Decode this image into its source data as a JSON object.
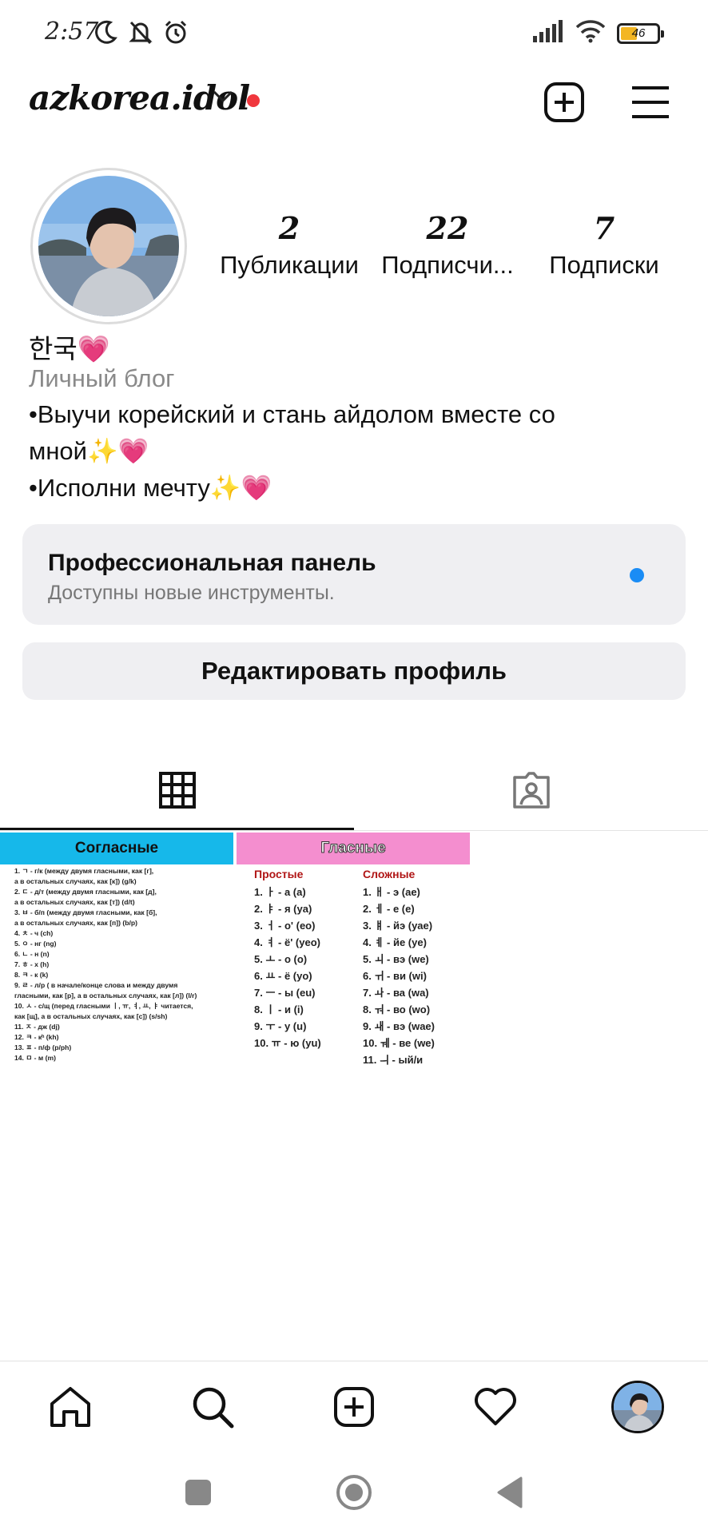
{
  "status_bar": {
    "time": "2:57",
    "battery_level": "46",
    "battery_fraction": 0.46
  },
  "header": {
    "username": "azkorea.idol"
  },
  "profile": {
    "stats": [
      {
        "value": "2",
        "label": "Публикации"
      },
      {
        "value": "22",
        "label": "Подписчи..."
      },
      {
        "value": "7",
        "label": "Подписки"
      }
    ],
    "name": "한국💗",
    "category": "Личный блог",
    "bio": "•Выучи корейский и стань айдолом вместе со\nмной✨💗\n•Исполни мечту✨💗"
  },
  "pro_panel": {
    "title": "Профессиональная панель",
    "subtitle": "Доступны новые инструменты."
  },
  "edit_button": "Редактировать профиль",
  "posts": [
    {
      "title": "Согласные",
      "lines": [
        "1. ㄱ - г/к (между двумя гласными, как [г],",
        "а в остальных случаях, как [к]) (g/k)",
        "2. ㄷ - д/т (между двумя гласными, как [д],",
        "а в остальных случаях, как [т]) (d/t)",
        "3. ㅂ - б/п (между двумя гласными, как [б],",
        "а в остальных случаях, как [п]) (b/p)",
        "4. ㅊ - ч (ch)",
        "5. ㅇ - нг (ng)",
        "6. ㄴ - н (n)",
        "7. ㅎ - х (h)",
        "8. ㅋ - к (k)",
        "9. ㄹ - л/р ( в начале/конце слова и между двумя",
        "гласными, как [р], а в остальных случаях, как [л]) (l/r)",
        "10. ㅅ - с/щ (перед гласными ㅣ, ㅠ, ㅕ, ㅛ, ㅑ читается,",
        "как [щ], а в остальных случаях, как [с]) (s/sh)",
        "11. ㅈ - дж (dj)",
        "12. ㅋ - кʰ (kh)",
        "13. ㅍ - п/ф (p/ph)",
        "14. ㅁ - м (m)"
      ]
    },
    {
      "title": "Гласные",
      "simple_title": "Простые",
      "complex_title": "Сложные",
      "simple": [
        "1. ㅏ - а (a)",
        "2. ㅑ - я (ya)",
        "3. ㅓ - о' (eo)",
        "4. ㅕ - ё' (yeo)",
        "5. ㅗ - о (o)",
        "6. ㅛ - ё (yo)",
        "7. ㅡ - ы (eu)",
        "8. ㅣ - и (i)",
        "9. ㅜ - у (u)",
        "10. ㅠ - ю (yu)"
      ],
      "complex": [
        "1. ㅐ - э (ae)",
        "2. ㅔ - е (e)",
        "3. ㅒ - йэ (yae)",
        "4. ㅖ - йе (ye)",
        "5. ㅚ - вэ (we)",
        "6. ㅟ - ви (wi)",
        "7. ㅘ - ва (wa)",
        "8. ㅝ - во (wo)",
        "9. ㅙ - вэ (wae)",
        "10. ㅞ - ве (we)",
        "11. ㅢ - ый/и"
      ]
    }
  ],
  "colors": {
    "notif_dot": "#f0373d",
    "pro_dot": "#1a8cf5",
    "panel_bg": "#efeff2",
    "post1_header": "#16b8ea",
    "post2_header": "#f48ecf"
  }
}
